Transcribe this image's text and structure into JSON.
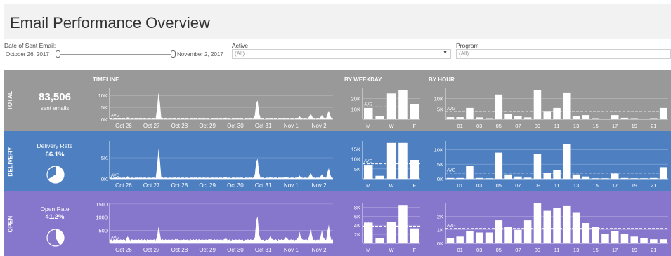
{
  "header": {
    "title": "Email Performance Overview"
  },
  "filters": {
    "date": {
      "label": "Date of Sent Email:",
      "start": "October 26, 2017",
      "end": "November 2, 2017"
    },
    "active": {
      "label": "Active",
      "value": "(All)"
    },
    "program": {
      "label": "Program",
      "value": "(All)"
    }
  },
  "section_heads": {
    "timeline": "TIMELINE",
    "weekday": "BY WEEKDAY",
    "hour": "BY HOUR"
  },
  "rows": [
    {
      "id": "total",
      "label": "TOTAL",
      "kpi": "83,506",
      "kpi_sub": "sent emails"
    },
    {
      "id": "delivery",
      "label": "DELIVERY",
      "kpi_title": "Delivery Rate",
      "kpi_value": "66.1%",
      "pie_fraction": 0.661
    },
    {
      "id": "open",
      "label": "OPEN",
      "kpi_title": "Open Rate",
      "kpi_value": "41.2%",
      "pie_fraction": 0.412
    }
  ],
  "colors": {
    "total_band": "#999999",
    "delivery_band": "#4d7fc1",
    "open_band": "#8676cc",
    "bar": "#ffffff",
    "header_bg": "#f2f2f2"
  },
  "chart_data": [
    {
      "type": "area",
      "row": "total",
      "panel": "timeline",
      "x_ticks": [
        "Oct 26",
        "Oct 27",
        "Oct 28",
        "Oct 29",
        "Oct 30",
        "Oct 31",
        "Nov 1",
        "Nov 2"
      ],
      "y_ticks": [
        "10K",
        "5K",
        "0K"
      ],
      "ylim": [
        0,
        13000
      ],
      "avg_label": "AVG",
      "avg": 400,
      "peaks": [
        [
          0.03,
          600
        ],
        [
          0.08,
          900
        ],
        [
          0.12,
          500
        ],
        [
          0.22,
          12500
        ],
        [
          0.3,
          300
        ],
        [
          0.39,
          500
        ],
        [
          0.45,
          300
        ],
        [
          0.52,
          800
        ],
        [
          0.58,
          500
        ],
        [
          0.66,
          10000
        ],
        [
          0.72,
          600
        ],
        [
          0.79,
          700
        ],
        [
          0.85,
          1200
        ],
        [
          0.9,
          2400
        ],
        [
          0.95,
          1800
        ],
        [
          0.98,
          4000
        ]
      ]
    },
    {
      "type": "bar",
      "row": "total",
      "panel": "weekday",
      "categories": [
        "M",
        "T",
        "W",
        "T",
        "F"
      ],
      "x_tick_labels": [
        "M",
        "",
        "W",
        "",
        "F"
      ],
      "values": [
        11000,
        3000,
        25000,
        28000,
        15000
      ],
      "y_ticks": [
        "20K",
        "10K"
      ],
      "ylim": [
        0,
        30000
      ],
      "avg_label": "AVG",
      "avg": 12000
    },
    {
      "type": "bar",
      "row": "total",
      "panel": "hour",
      "categories": [
        "00",
        "01",
        "02",
        "03",
        "04",
        "05",
        "06",
        "07",
        "08",
        "09",
        "10",
        "11",
        "12",
        "13",
        "14",
        "15",
        "16",
        "17",
        "18",
        "19",
        "20",
        "21",
        "22"
      ],
      "x_tick_labels": [
        "",
        "01",
        "",
        "03",
        "",
        "05",
        "",
        "07",
        "",
        "09",
        "",
        "11",
        "",
        "13",
        "",
        "15",
        "",
        "17",
        "",
        "19",
        "",
        "21",
        ""
      ],
      "values": [
        1000,
        1000,
        5500,
        900,
        500,
        12000,
        2500,
        1500,
        900,
        14000,
        4000,
        5500,
        13000,
        1500,
        2000,
        500,
        300,
        2000,
        700,
        500,
        300,
        500,
        5500
      ],
      "y_ticks": [
        "10K",
        "5K"
      ],
      "ylim": [
        0,
        15000
      ],
      "avg_label": "AVG",
      "avg": 3700
    },
    {
      "type": "area",
      "row": "delivery",
      "panel": "timeline",
      "x_ticks": [
        "Oct 26",
        "Oct 27",
        "Oct 28",
        "Oct 29",
        "Oct 30",
        "Oct 31",
        "Nov 1",
        "Nov 2"
      ],
      "y_ticks": [
        "5K",
        "0K"
      ],
      "ylim": [
        0,
        9000
      ],
      "avg_label": "AVG",
      "avg": 200,
      "peaks": [
        [
          0.03,
          400
        ],
        [
          0.08,
          700
        ],
        [
          0.12,
          300
        ],
        [
          0.22,
          8000
        ],
        [
          0.3,
          200
        ],
        [
          0.39,
          300
        ],
        [
          0.45,
          200
        ],
        [
          0.52,
          500
        ],
        [
          0.58,
          300
        ],
        [
          0.66,
          6000
        ],
        [
          0.72,
          400
        ],
        [
          0.79,
          500
        ],
        [
          0.85,
          800
        ],
        [
          0.9,
          1500
        ],
        [
          0.95,
          1100
        ],
        [
          0.98,
          2800
        ]
      ]
    },
    {
      "type": "bar",
      "row": "delivery",
      "panel": "weekday",
      "categories": [
        "M",
        "T",
        "W",
        "T",
        "F"
      ],
      "x_tick_labels": [
        "M",
        "",
        "W",
        "",
        "F"
      ],
      "values": [
        7000,
        1500,
        18000,
        18000,
        9500
      ],
      "y_ticks": [
        "15K",
        "10K",
        "5K"
      ],
      "ylim": [
        0,
        19000
      ],
      "avg_label": "AVG",
      "avg": 7500
    },
    {
      "type": "bar",
      "row": "delivery",
      "panel": "hour",
      "categories": [
        "00",
        "01",
        "02",
        "03",
        "04",
        "05",
        "06",
        "07",
        "08",
        "09",
        "10",
        "11",
        "12",
        "13",
        "14",
        "15",
        "16",
        "17",
        "18",
        "19",
        "20",
        "21",
        "22"
      ],
      "x_tick_labels": [
        "",
        "01",
        "",
        "03",
        "",
        "05",
        "",
        "07",
        "",
        "09",
        "",
        "11",
        "",
        "13",
        "",
        "15",
        "",
        "17",
        "",
        "19",
        "",
        "21",
        ""
      ],
      "values": [
        300,
        300,
        4500,
        300,
        200,
        9000,
        1500,
        800,
        400,
        8500,
        2000,
        3000,
        12000,
        1500,
        800,
        200,
        200,
        1800,
        300,
        200,
        200,
        300,
        4000
      ],
      "y_ticks": [
        "10K",
        "5K",
        "0K"
      ],
      "ylim": [
        0,
        13000
      ],
      "avg_label": "AVG",
      "avg": 2000
    },
    {
      "type": "area",
      "row": "open",
      "panel": "timeline",
      "x_ticks": [
        "Oct 26",
        "Oct 27",
        "Oct 28",
        "Oct 29",
        "Oct 30",
        "Oct 31",
        "Nov 1",
        "Nov 2"
      ],
      "y_ticks": [
        "1500",
        "1000",
        "500"
      ],
      "ylim": [
        0,
        1550
      ],
      "avg_label": "AVG",
      "avg": 120,
      "peaks": [
        [
          0.03,
          200
        ],
        [
          0.08,
          300
        ],
        [
          0.12,
          150
        ],
        [
          0.22,
          700
        ],
        [
          0.3,
          150
        ],
        [
          0.39,
          180
        ],
        [
          0.45,
          150
        ],
        [
          0.52,
          200
        ],
        [
          0.58,
          150
        ],
        [
          0.66,
          1300
        ],
        [
          0.72,
          300
        ],
        [
          0.79,
          300
        ],
        [
          0.85,
          450
        ],
        [
          0.9,
          600
        ],
        [
          0.95,
          500
        ],
        [
          0.98,
          800
        ]
      ]
    },
    {
      "type": "bar",
      "row": "open",
      "panel": "weekday",
      "categories": [
        "M",
        "T",
        "W",
        "T",
        "F"
      ],
      "x_tick_labels": [
        "M",
        "",
        "W",
        "",
        "F"
      ],
      "values": [
        4600,
        1200,
        4700,
        8500,
        3300
      ],
      "y_ticks": [
        "8K",
        "6K",
        "4K",
        "2K"
      ],
      "ylim": [
        0,
        9000
      ],
      "avg_label": "AVG",
      "avg": 3800
    },
    {
      "type": "bar",
      "row": "open",
      "panel": "hour",
      "categories": [
        "00",
        "01",
        "02",
        "03",
        "04",
        "05",
        "06",
        "07",
        "08",
        "09",
        "10",
        "11",
        "12",
        "13",
        "14",
        "15",
        "16",
        "17",
        "18",
        "19",
        "20",
        "21",
        "22"
      ],
      "x_tick_labels": [
        "",
        "01",
        "",
        "03",
        "",
        "05",
        "",
        "07",
        "",
        "09",
        "",
        "11",
        "",
        "13",
        "",
        "15",
        "",
        "17",
        "",
        "19",
        "",
        "21",
        ""
      ],
      "values": [
        400,
        500,
        900,
        800,
        800,
        1700,
        1200,
        1000,
        1700,
        3000,
        2400,
        2600,
        2800,
        2300,
        1500,
        1200,
        700,
        900,
        700,
        500,
        400,
        300,
        300
      ],
      "y_ticks": [
        "2K",
        "1K",
        "0K"
      ],
      "ylim": [
        0,
        3000
      ],
      "avg_label": "AVG",
      "avg": 1100
    }
  ]
}
